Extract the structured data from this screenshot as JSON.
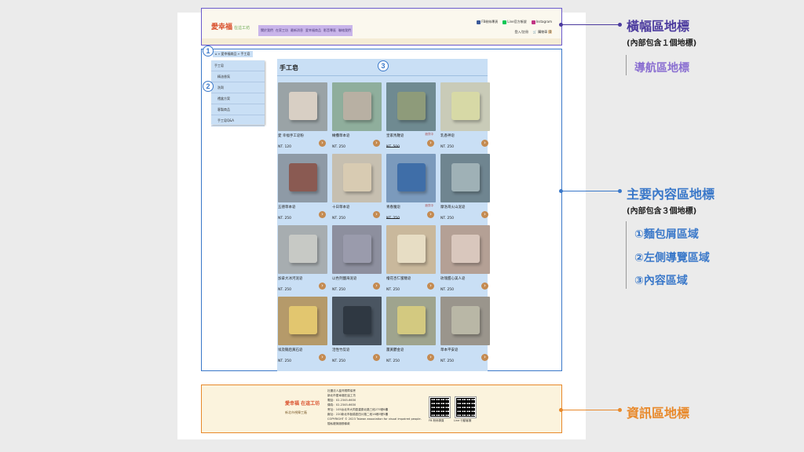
{
  "banner": {
    "logo_text": "愛幸福",
    "logo_sub": "在這工坊",
    "menu": [
      "關於我們",
      "在家工坊",
      "最新消息",
      "愛幸福商品",
      "影音專區",
      "聯絡我們"
    ],
    "social": [
      {
        "label": "FB粉絲專頁",
        "color": "#3b5998",
        "icon": "facebook-icon"
      },
      {
        "label": "Line官方帳號",
        "color": "#06c755",
        "icon": "line-icon"
      },
      {
        "label": "Instagram",
        "color": "#c13584",
        "icon": "instagram-icon"
      }
    ],
    "login": "登入/註冊",
    "cart": "購物車",
    "cart_count": "0"
  },
  "main": {
    "breadcrumb": "⌂ » 愛幸福商品 » 手工皂",
    "sidenav": [
      "手工皂",
      "精油香氛",
      "洗劑",
      "禮盒方案",
      "客製商品",
      "手工皂Q&A"
    ],
    "content_title": "手工皂",
    "products": [
      {
        "name": "愛 幸福手工皂粉",
        "price": "NT. 120",
        "img": "#9aa3a6",
        "soap": "#d8cfc4",
        "badge": "",
        "strike": false
      },
      {
        "name": "橄欖草本皂",
        "price": "NT. 250",
        "img": "#8fae9c",
        "soap": "#b8b0a3",
        "badge": "",
        "strike": false
      },
      {
        "name": "皇家馬鞭皂",
        "price": "NT. 500",
        "img": "#6f8a91",
        "soap": "#8e9b7a",
        "badge": "缺貨中",
        "strike": true
      },
      {
        "name": "乳香神皂",
        "price": "NT. 250",
        "img": "#c9cbb8",
        "soap": "#d7d9a6",
        "badge": "",
        "strike": false
      },
      {
        "name": "五德草本皂",
        "price": "NT. 250",
        "img": "#8e9aa6",
        "soap": "#8a5a52",
        "badge": "",
        "strike": false
      },
      {
        "name": "十日草本皂",
        "price": "NT. 250",
        "img": "#c6bfb0",
        "soap": "#d8cbb2",
        "badge": "",
        "strike": false
      },
      {
        "name": "青春魔皂",
        "price": "NT. 250",
        "img": "#7b9abc",
        "soap": "#3f6ea8",
        "badge": "缺貨中",
        "strike": true
      },
      {
        "name": "摩洛哥火山泥皂",
        "price": "NT. 250",
        "img": "#6f8590",
        "soap": "#9fb1b6",
        "badge": "",
        "strike": false
      },
      {
        "name": "加拿大冰河泥皂",
        "price": "NT. 250",
        "img": "#a7adb0",
        "soap": "#c7c9c5",
        "badge": "",
        "strike": false
      },
      {
        "name": "以色列鹽海泥皂",
        "price": "NT. 250",
        "img": "#8d8f9e",
        "soap": "#9a9bac",
        "badge": "",
        "strike": false
      },
      {
        "name": "檜花杏仁蜜糖皂",
        "price": "NT. 250",
        "img": "#c9b89c",
        "soap": "#e7ddc4",
        "badge": "",
        "strike": false
      },
      {
        "name": "玫瑰甜心美人皂",
        "price": "NT. 250",
        "img": "#b4a095",
        "soap": "#d9c7bd",
        "badge": "",
        "strike": false
      },
      {
        "name": "埃及豔后黃石皂",
        "price": "NT. 250",
        "img": "#b59a6a",
        "soap": "#e2c66f",
        "badge": "",
        "strike": false
      },
      {
        "name": "活性竹炭皂",
        "price": "NT. 250",
        "img": "#4a5561",
        "soap": "#2f3842",
        "badge": "",
        "strike": false
      },
      {
        "name": "薑黃鬱金皂",
        "price": "NT. 250",
        "img": "#9fa48e",
        "soap": "#d3c980",
        "badge": "",
        "strike": false
      },
      {
        "name": "草本平安皂",
        "price": "NT. 250",
        "img": "#9a958c",
        "soap": "#b9b7a6",
        "badge": "",
        "strike": false
      }
    ]
  },
  "footer": {
    "logo": "愛幸福 在這工坊",
    "logo2": "新北市視障工廠",
    "info": [
      "社團法人臺灣視障協會",
      "新北市愛幸福在這工坊",
      "電話：02-2345-6630",
      "傳真：02-2345-6630",
      "會址：105台北市大同區重慶北路三段275號6樓",
      "廠址：220新北市板橋區四川路二段16巷5號5樓",
      "COPYRIGHT © 2023 Taiwan association for visual impaired people.",
      "隱私權與服務條款"
    ],
    "qr_labels": [
      "FB 粉絲專頁",
      "Line 行動客服"
    ]
  },
  "annotations": {
    "banner_title": "橫幅區地標",
    "banner_sub": "(內部包含１個地標)",
    "nav_item": "導航區地標",
    "main_title": "主要內容區地標",
    "main_sub": "(內部包含３個地標)",
    "main_items": [
      "①麵包屑區域",
      "②左側導覽區域",
      "③內容區域"
    ],
    "footer_title": "資訊區地標",
    "markers": [
      "1",
      "2",
      "3"
    ],
    "colors": {
      "banner": "#4b3a9e",
      "nav": "#8a6fd1",
      "main": "#3a78c9",
      "footer": "#e8892b"
    }
  }
}
